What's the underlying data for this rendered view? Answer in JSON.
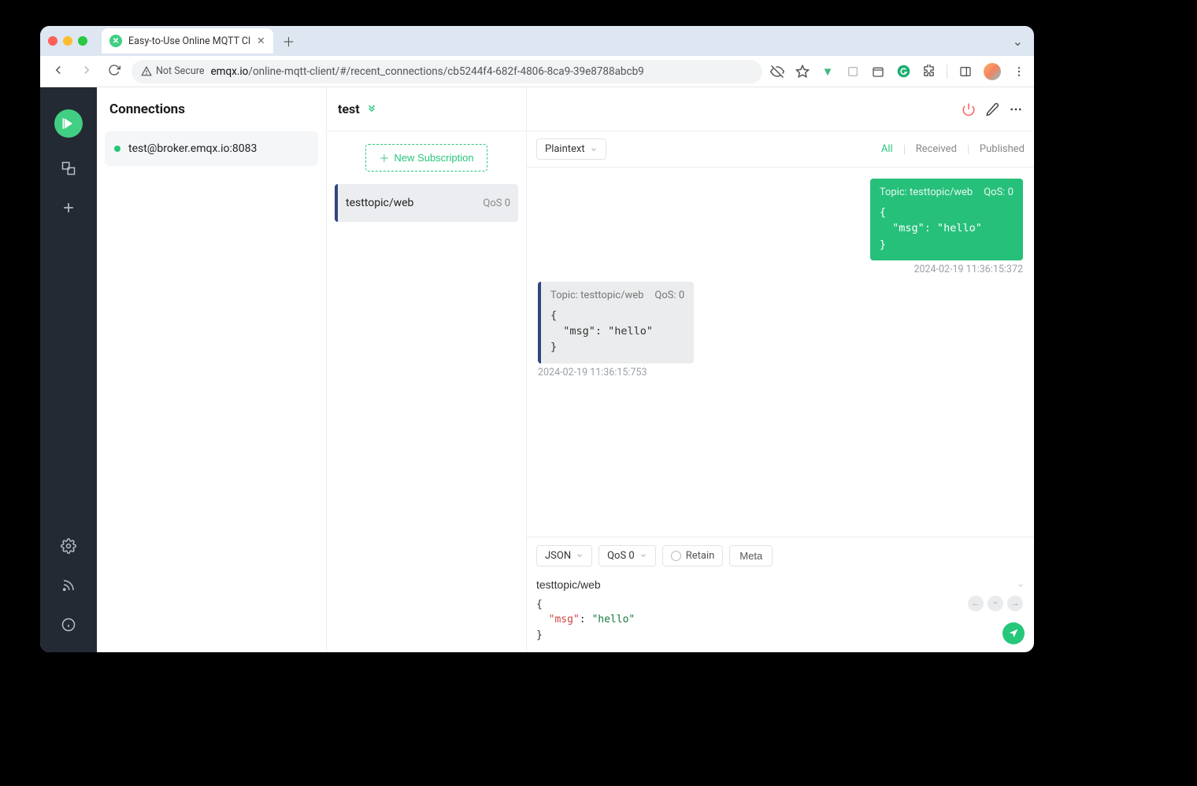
{
  "browser": {
    "tab_title": "Easy-to-Use Online MQTT Cl",
    "not_secure": "Not Secure",
    "url_domain": "emqx.io",
    "url_path": "/online-mqtt-client/#/recent_connections/cb5244f4-682f-4806-8ca9-39e8788abcb9"
  },
  "sidebar": {
    "title": "Connections",
    "items": [
      {
        "label": "test@broker.emqx.io:8083"
      }
    ]
  },
  "subs": {
    "title": "test",
    "new_btn": "New Subscription",
    "items": [
      {
        "topic": "testtopic/web",
        "qos": "QoS 0"
      }
    ]
  },
  "filters": {
    "format": "Plaintext",
    "all": "All",
    "received": "Received",
    "published": "Published"
  },
  "messages": [
    {
      "dir": "sent",
      "topic_label": "Topic: testtopic/web",
      "qos_label": "QoS: 0",
      "payload": "{\n  \"msg\": \"hello\"\n}",
      "ts": "2024-02-19 11:36:15:372"
    },
    {
      "dir": "recv",
      "topic_label": "Topic: testtopic/web",
      "qos_label": "QoS: 0",
      "payload": "{\n  \"msg\": \"hello\"\n}",
      "ts": "2024-02-19 11:36:15:753"
    }
  ],
  "composer": {
    "format": "JSON",
    "qos": "QoS 0",
    "retain": "Retain",
    "meta": "Meta",
    "topic": "testtopic/web",
    "payload_open": "{",
    "payload_key": "\"msg\"",
    "payload_colon": ": ",
    "payload_val": "\"hello\"",
    "payload_close": "}"
  }
}
